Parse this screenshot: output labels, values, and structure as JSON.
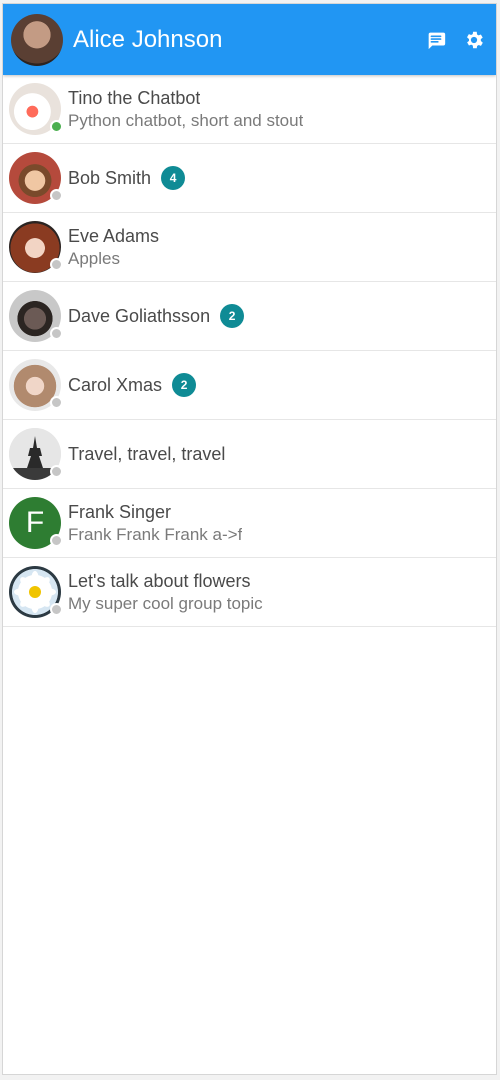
{
  "header": {
    "title": "Alice Johnson",
    "actions": [
      {
        "icon": "chat-bubble-icon"
      },
      {
        "icon": "gear-icon"
      }
    ],
    "colors": {
      "bar": "#2196f3",
      "text": "#ffffff"
    }
  },
  "contacts": [
    {
      "name": "Tino the Chatbot",
      "comment": "Python chatbot, short and stout",
      "badge": "",
      "presence": "online",
      "avatar": "photo"
    },
    {
      "name": "Bob Smith",
      "comment": "",
      "badge": "4",
      "presence": "offline",
      "avatar": "photo"
    },
    {
      "name": "Eve Adams",
      "comment": "Apples",
      "badge": "",
      "presence": "offline",
      "avatar": "photo"
    },
    {
      "name": "Dave Goliathsson",
      "comment": "",
      "badge": "2",
      "presence": "offline",
      "avatar": "photo"
    },
    {
      "name": "Carol Xmas",
      "comment": "",
      "badge": "2",
      "presence": "offline",
      "avatar": "photo"
    },
    {
      "name": "Travel, travel, travel",
      "comment": "",
      "badge": "",
      "presence": "offline",
      "avatar": "eiffel-tower"
    },
    {
      "name": "Frank Singer",
      "comment": "Frank Frank Frank a->f",
      "badge": "",
      "presence": "offline",
      "avatar": "letter",
      "initial": "F"
    },
    {
      "name": "Let's talk about flowers",
      "comment": "My super cool group topic",
      "badge": "",
      "presence": "offline",
      "avatar": "flower"
    }
  ],
  "colors": {
    "badge": "#0f8b95",
    "online": "#4caf50",
    "offline": "#c6c6c6",
    "frank_avatar": "#2e7d32"
  }
}
